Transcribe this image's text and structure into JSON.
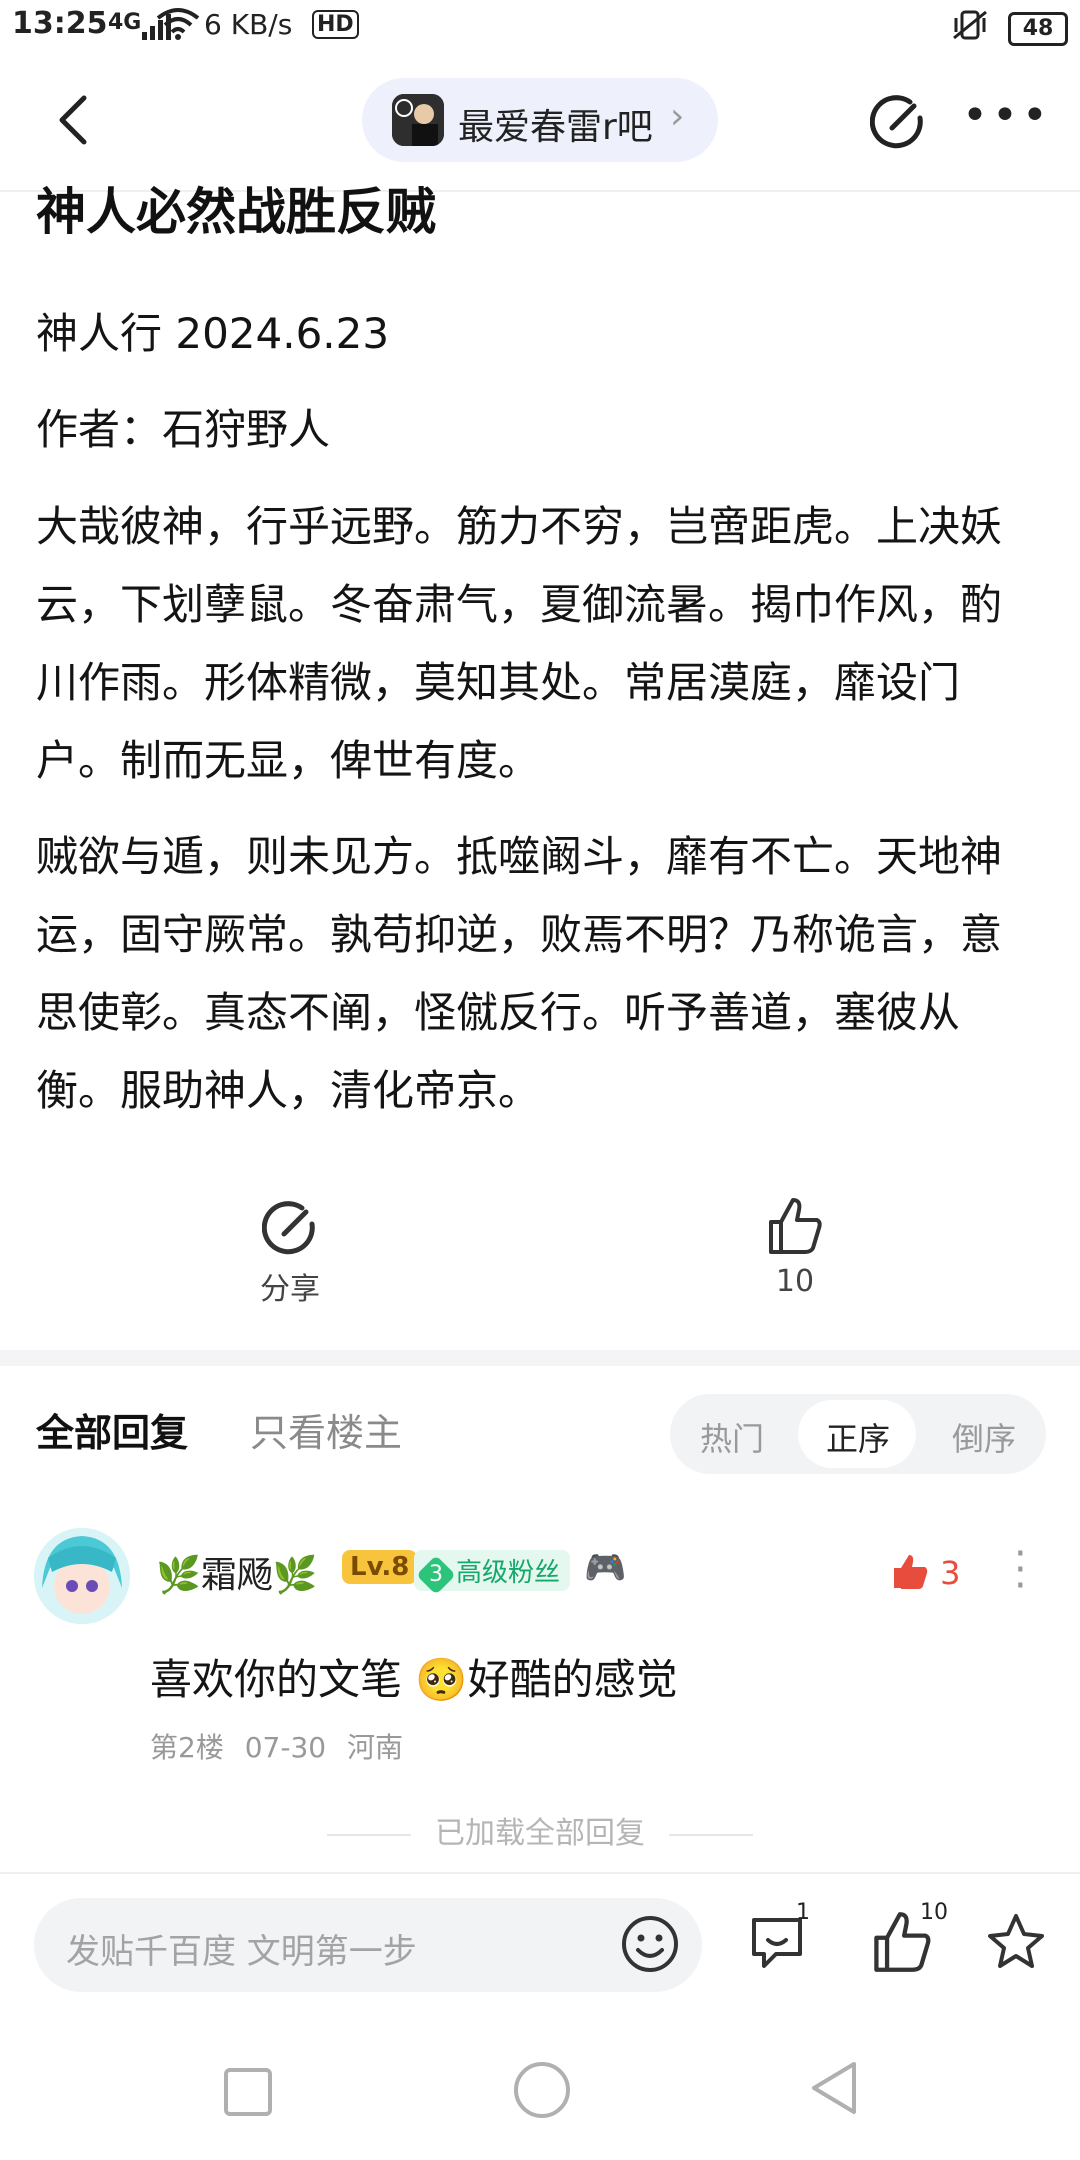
{
  "status_bar": {
    "time": "13:25",
    "network": "4G",
    "speed": "6 KB/s",
    "hd": "HD",
    "battery": "48"
  },
  "top_nav": {
    "forum_name": "最爱春雷r吧"
  },
  "article": {
    "title_partial": "神人必然战胜反贼",
    "line1": "神人行 2024.6.23",
    "line2": "作者：石狩野人",
    "para1_lines": [
      "大哉彼神，行乎远野。筋力不穷，岂啻距虎。上决妖",
      "云，下划孽鼠。冬奋肃气，夏御流暑。揭巾作风，酌",
      "川作雨。形体精微，莫知其处。常居漠庭，靡设门",
      "户。制而无显，俾世有度。"
    ],
    "para2_lines": [
      "贼欲与遁，则未见方。抵噬阚斗，靡有不亡。天地神",
      "运，固守厥常。孰苟抑逆，败焉不明？乃称诡言，意",
      "思使彰。真态不阐，怪僦反行。听予善道，塞彼从",
      "衡。服助神人，清化帝京。"
    ]
  },
  "actions": {
    "share_label": "分享",
    "like_count": "10"
  },
  "replies": {
    "tab_all": "全部回复",
    "tab_host_only": "只看楼主",
    "sort": {
      "hot": "热门",
      "asc": "正序",
      "desc": "倒序",
      "selected": "正序"
    },
    "comment": {
      "username": "🌿霜飏🌿",
      "level": "Lv.8",
      "fan_level": "3",
      "fan_label": "高级粉丝",
      "likes": "3",
      "text_before": "喜欢你的文笔 ",
      "text_emoji": "🥺",
      "text_after": "好酷的感觉",
      "floor": "第2楼",
      "date": "07-30",
      "location": "河南"
    },
    "loaded_text": "已加载全部回复"
  },
  "bottom_bar": {
    "placeholder": "发贴千百度 文明第一步",
    "comment_count": "1",
    "like_count": "10"
  },
  "colors": {
    "accent_red": "#e84c3d",
    "pill_bg": "#eef1fc",
    "fan_green": "#15a86d",
    "level_gold": "#f7c43c"
  }
}
